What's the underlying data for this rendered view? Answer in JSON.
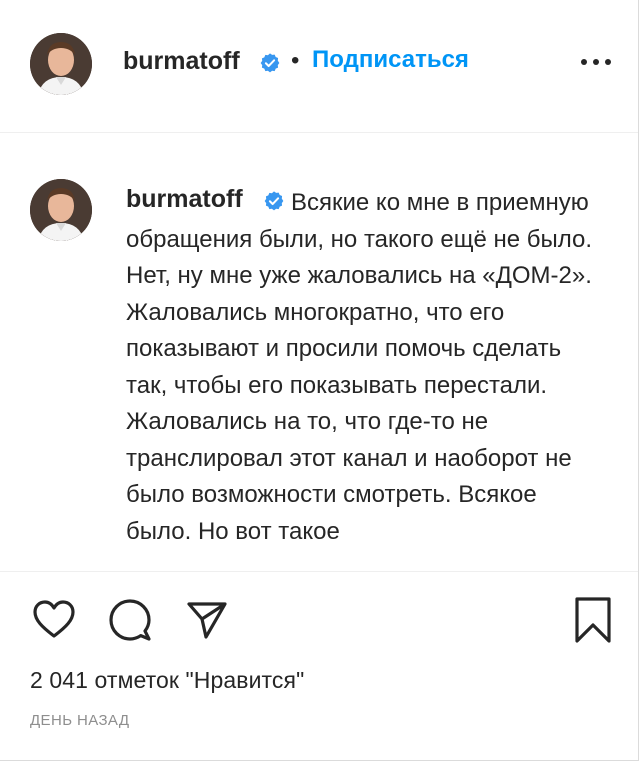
{
  "post": {
    "author": "burmatoff",
    "follow_label": "Подписаться",
    "separator": "•",
    "caption": "Всякие ко мне в приемную обращения были, но такого ещё не было. Нет, ну мне уже жаловались на «ДОМ-2». Жаловались многократно, что его показывают и просили помочь сделать так, чтобы его показывать перестали. Жаловались на то, что где-то не транслировал этот канал и наоборот не было возможности смотреть. Всякое было. Но вот такое",
    "likes": "2 041 отметок \"Нравится\"",
    "time_ago": "ДЕНЬ НАЗАД"
  },
  "icons": {
    "verified": "verified-badge-icon",
    "more": "more-options-icon",
    "like": "heart-icon",
    "comment": "comment-icon",
    "share": "paper-plane-icon",
    "save": "bookmark-icon"
  },
  "colors": {
    "accent": "#0095f6",
    "text": "#262626",
    "muted": "#8e8e8e",
    "border": "#dbdbdb"
  }
}
